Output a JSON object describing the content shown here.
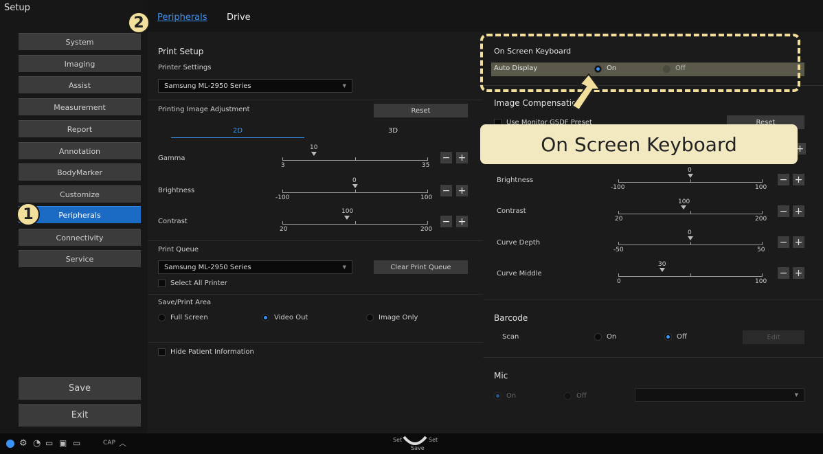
{
  "sidebar": {
    "title": "Setup",
    "items": [
      {
        "label": "System"
      },
      {
        "label": "Imaging"
      },
      {
        "label": "Assist"
      },
      {
        "label": "Measurement"
      },
      {
        "label": "Report"
      },
      {
        "label": "Annotation"
      },
      {
        "label": "BodyMarker"
      },
      {
        "label": "Customize"
      },
      {
        "label": "Peripherals"
      },
      {
        "label": "Connectivity"
      },
      {
        "label": "Service"
      }
    ],
    "save_label": "Save",
    "exit_label": "Exit"
  },
  "badges": {
    "one": "1",
    "two": "2"
  },
  "tabs": [
    {
      "label": "Peripherals",
      "active": true
    },
    {
      "label": "Drive",
      "active": false
    }
  ],
  "print_setup": {
    "title": "Print Setup",
    "printer_settings_label": "Printer Settings",
    "printer_value": "Samsung ML-2950 Series",
    "adjust_label": "Printing Image Adjustment",
    "reset_label": "Reset",
    "tab_2d": "2D",
    "tab_3d": "3D",
    "sliders": [
      {
        "label": "Gamma",
        "min": "3",
        "max": "35",
        "value": "10"
      },
      {
        "label": "Brightness",
        "min": "-100",
        "max": "100",
        "value": "0"
      },
      {
        "label": "Contrast",
        "min": "20",
        "max": "200",
        "value": "100"
      }
    ],
    "queue_label": "Print Queue",
    "queue_value": "Samsung ML-2950 Series",
    "clear_label": "Clear Print Queue",
    "select_all_label": "Select All Printer",
    "area_label": "Save/Print Area",
    "area_options": [
      {
        "label": "Full Screen",
        "selected": false
      },
      {
        "label": "Video Out",
        "selected": true
      },
      {
        "label": "Image Only",
        "selected": false
      }
    ],
    "hide_patient_label": "Hide Patient Information"
  },
  "osk": {
    "title": "On Screen Keyboard",
    "auto_label": "Auto Display",
    "on_label": "On",
    "off_label": "Off",
    "callout": "On Screen Keyboard"
  },
  "image_comp": {
    "title": "Image Compensatio",
    "gsdf_label": "Use Monitor GSDF Preset",
    "reset_label": "Reset",
    "sliders": [
      {
        "label": "Brightness",
        "min": "-100",
        "max": "100",
        "value": "0"
      },
      {
        "label": "Contrast",
        "min": "20",
        "max": "200",
        "value": "100"
      },
      {
        "label": "Curve Depth",
        "min": "-50",
        "max": "50",
        "value": "0"
      },
      {
        "label": "Curve Middle",
        "min": "0",
        "max": "100",
        "value": "30"
      }
    ]
  },
  "barcode": {
    "title": "Barcode",
    "scan_label": "Scan",
    "on_label": "On",
    "off_label": "Off",
    "edit_label": "Edit"
  },
  "mic": {
    "title": "Mic",
    "on_label": "On",
    "off_label": "Off"
  },
  "bottombar": {
    "cap_label": "CAP",
    "set_left": "Set",
    "set_right": "Set",
    "save_small": "Save"
  }
}
